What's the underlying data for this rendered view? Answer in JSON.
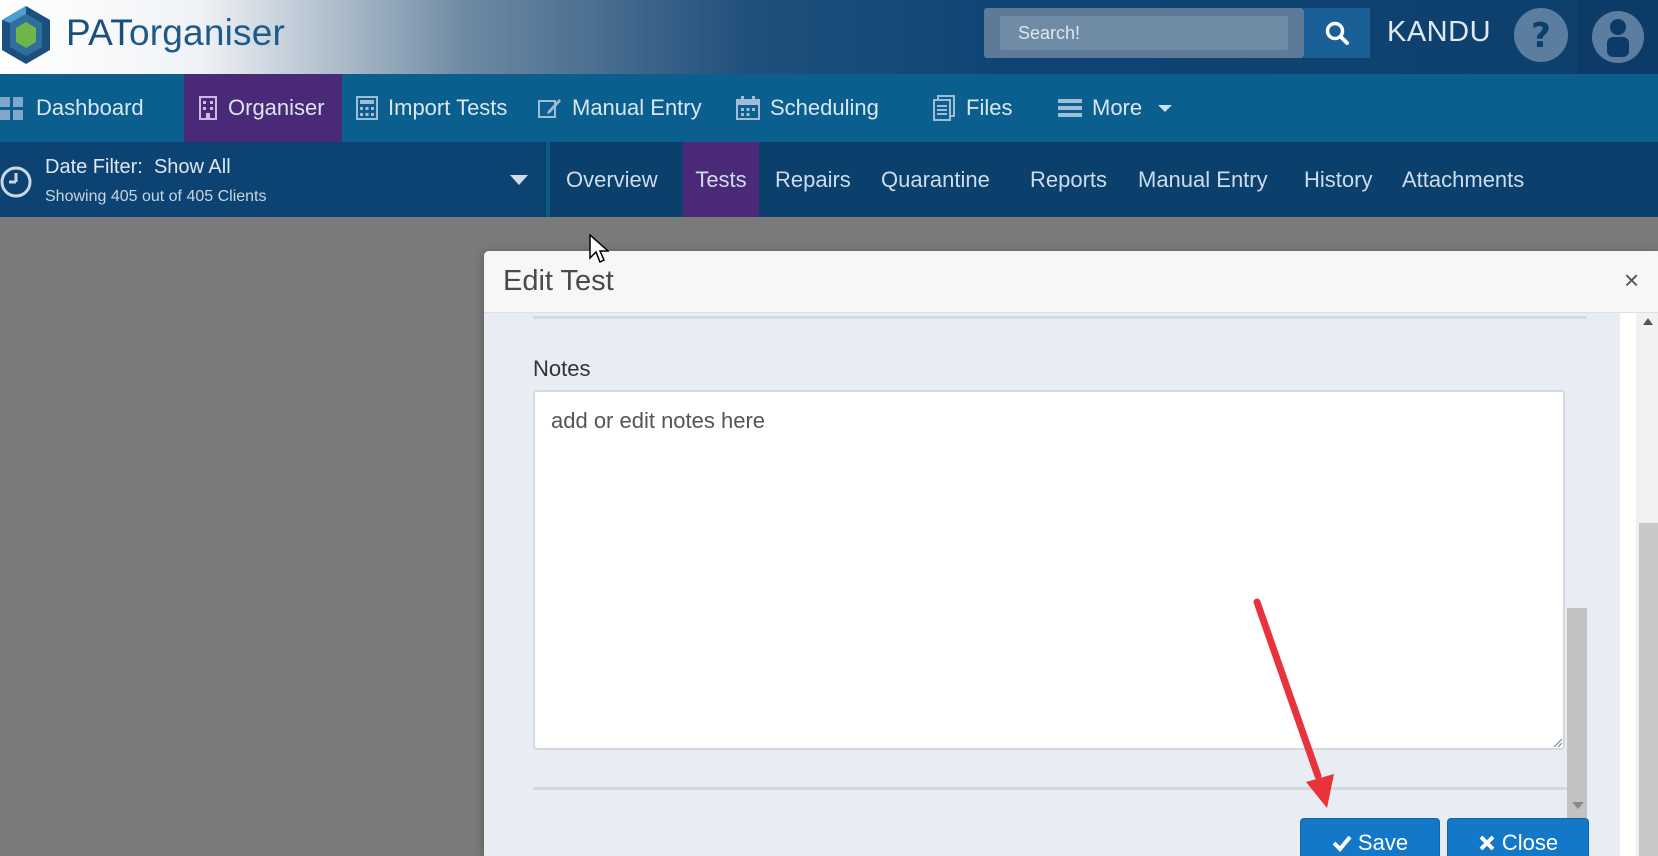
{
  "header": {
    "brand_prefix": "PAT",
    "brand_suffix": "organiser",
    "search_placeholder": "Search!",
    "user_name": "KANDU"
  },
  "main_nav": [
    {
      "label": "Dashboard",
      "icon": "dashboard-icon"
    },
    {
      "label": "Organiser",
      "icon": "building-icon",
      "active": true
    },
    {
      "label": "Import Tests",
      "icon": "calculator-icon"
    },
    {
      "label": "Manual Entry",
      "icon": "edit-icon"
    },
    {
      "label": "Scheduling",
      "icon": "calendar-icon"
    },
    {
      "label": "Files",
      "icon": "files-icon"
    },
    {
      "label": "More",
      "icon": "menu-icon"
    }
  ],
  "date_filter": {
    "title_prefix": "Date Filter:",
    "title_value": "Show All",
    "subtitle": "Showing 405 out of 405 Clients"
  },
  "sub_nav": [
    {
      "label": "Overview"
    },
    {
      "label": "Tests",
      "active": true
    },
    {
      "label": "Repairs"
    },
    {
      "label": "Quarantine"
    },
    {
      "label": "Reports"
    },
    {
      "label": "Manual Entry"
    },
    {
      "label": "History"
    },
    {
      "label": "Attachments"
    }
  ],
  "modal": {
    "title": "Edit Test",
    "close_glyph": "×",
    "notes_label": "Notes",
    "notes_placeholder": "add or edit notes here",
    "save_label": "Save",
    "close_label": "Close"
  },
  "colors": {
    "active_nav": "#4a2a78",
    "main_nav_bg": "#0b5f8e",
    "sub_nav_bg": "#0b3f6c",
    "button_blue": "#1478c8",
    "annotation_arrow": "#e8323c"
  }
}
